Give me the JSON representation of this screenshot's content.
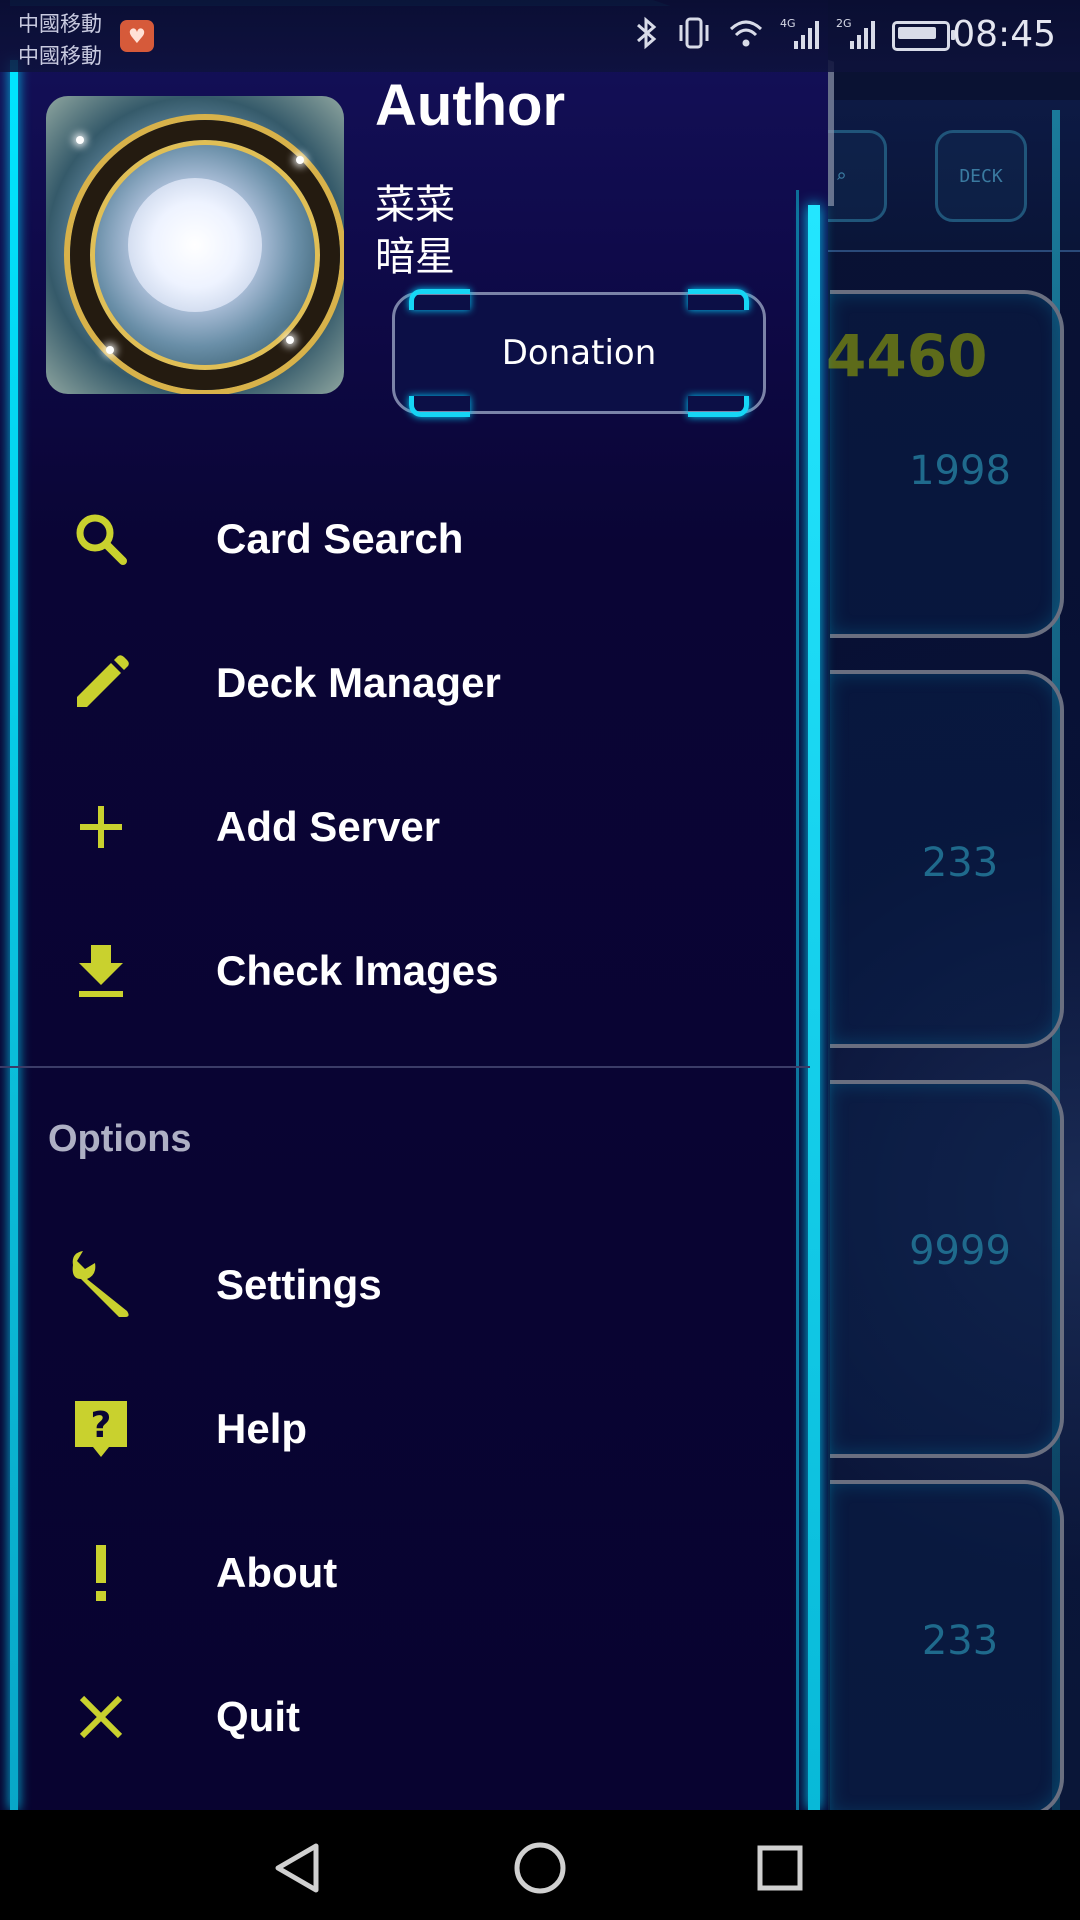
{
  "status_bar": {
    "carrier_1": "中國移動",
    "carrier_2": "中國移動",
    "time": "08:45",
    "icons": [
      "bluetooth-icon",
      "vibrate-icon",
      "wifi-icon",
      "signal-4g-icon",
      "signal-2g-icon",
      "battery-icon"
    ]
  },
  "drawer": {
    "header": {
      "title": "Author",
      "name_line_1": "菜菜",
      "name_line_2": "暗星",
      "donation_label": "Donation"
    },
    "menu_items": [
      {
        "label": "Card Search",
        "icon": "search-icon"
      },
      {
        "label": "Deck Manager",
        "icon": "pencil-icon"
      },
      {
        "label": "Add Server",
        "icon": "plus-icon"
      },
      {
        "label": "Check Images",
        "icon": "download-icon"
      }
    ],
    "options_section": {
      "title": "Options",
      "items": [
        {
          "label": "Settings",
          "icon": "wrench-icon"
        },
        {
          "label": "Help",
          "icon": "help-icon"
        },
        {
          "label": "About",
          "icon": "exclamation-icon"
        },
        {
          "label": "Quit",
          "icon": "close-icon"
        }
      ]
    }
  },
  "background": {
    "score": "4460",
    "values": [
      "1998",
      "233",
      "9999",
      "233"
    ]
  },
  "nav_bar": {
    "buttons": [
      "back-icon",
      "home-icon",
      "recents-icon"
    ]
  },
  "colors": {
    "accent_icon": "#c9d12e",
    "drawer_bg": "#0a0535",
    "neon_edge": "#00d7ff"
  }
}
